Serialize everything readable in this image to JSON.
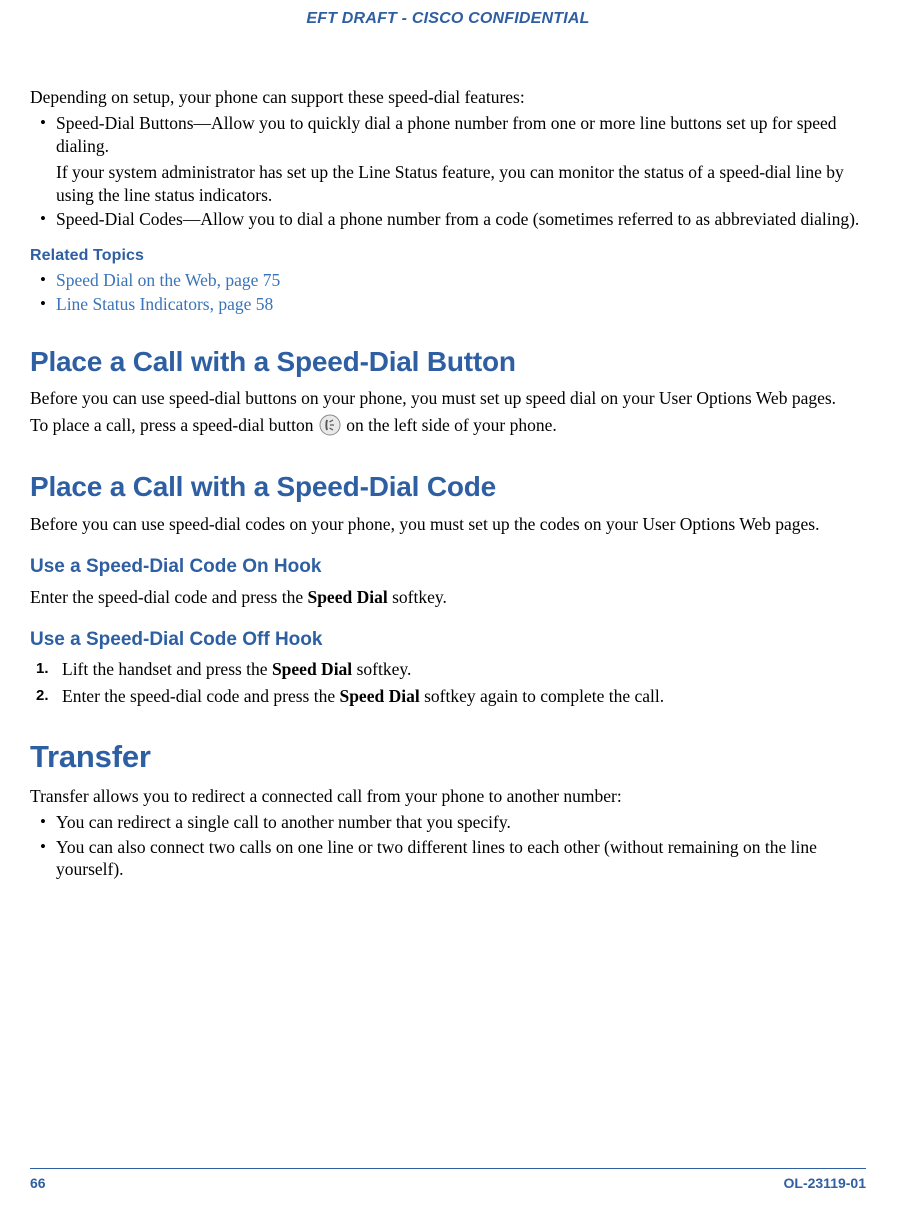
{
  "header": {
    "confidential": "EFT DRAFT - CISCO CONFIDENTIAL"
  },
  "intro": {
    "para1": "Depending on setup, your phone can support these speed-dial features:",
    "bullet1_main": "Speed-Dial Buttons—Allow you to quickly dial a phone number from one or more line buttons set up for speed dialing.",
    "bullet1_sub": "If your system administrator has set up the Line Status feature, you can monitor the status of a speed-dial line by using the line status indicators.",
    "bullet2": "Speed-Dial Codes—Allow you to dial a phone number from a code (sometimes referred to as abbreviated dialing)."
  },
  "related": {
    "heading": "Related Topics",
    "link1": "Speed Dial on the Web, page 75",
    "link2": "Line Status Indicators, page 58"
  },
  "sdbutton": {
    "heading": "Place a Call with a Speed-Dial Button",
    "para1": "Before you can use speed-dial buttons on your phone, you must set up speed dial on your User Options Web pages.",
    "para2a": "To place a call, press a speed-dial button ",
    "para2b": " on the left side of your phone."
  },
  "sdcode": {
    "heading": "Place a Call with a Speed-Dial Code",
    "para1": "Before you can use speed-dial codes on your phone, you must set up the codes on your User Options Web pages."
  },
  "onhook": {
    "heading": "Use a Speed-Dial Code On Hook",
    "para_a": "Enter the speed-dial code and press the ",
    "para_b": "Speed Dial",
    "para_c": " softkey."
  },
  "offhook": {
    "heading": "Use a Speed-Dial Code Off Hook",
    "step1_num": "1.",
    "step1_a": "Lift the handset and press the ",
    "step1_b": "Speed Dial",
    "step1_c": " softkey.",
    "step2_num": "2.",
    "step2_a": "Enter the speed-dial code and press the ",
    "step2_b": "Speed Dial",
    "step2_c": " softkey again to complete the call."
  },
  "transfer": {
    "heading": "Transfer",
    "para1": "Transfer allows you to redirect a connected call from your phone to another number:",
    "bullet1": "You can redirect a single call to another number that you specify.",
    "bullet2": "You can also connect two calls on one line or two different lines to each other (without remaining on the line yourself)."
  },
  "footer": {
    "page": "66",
    "docnum": "OL-23119-01"
  }
}
